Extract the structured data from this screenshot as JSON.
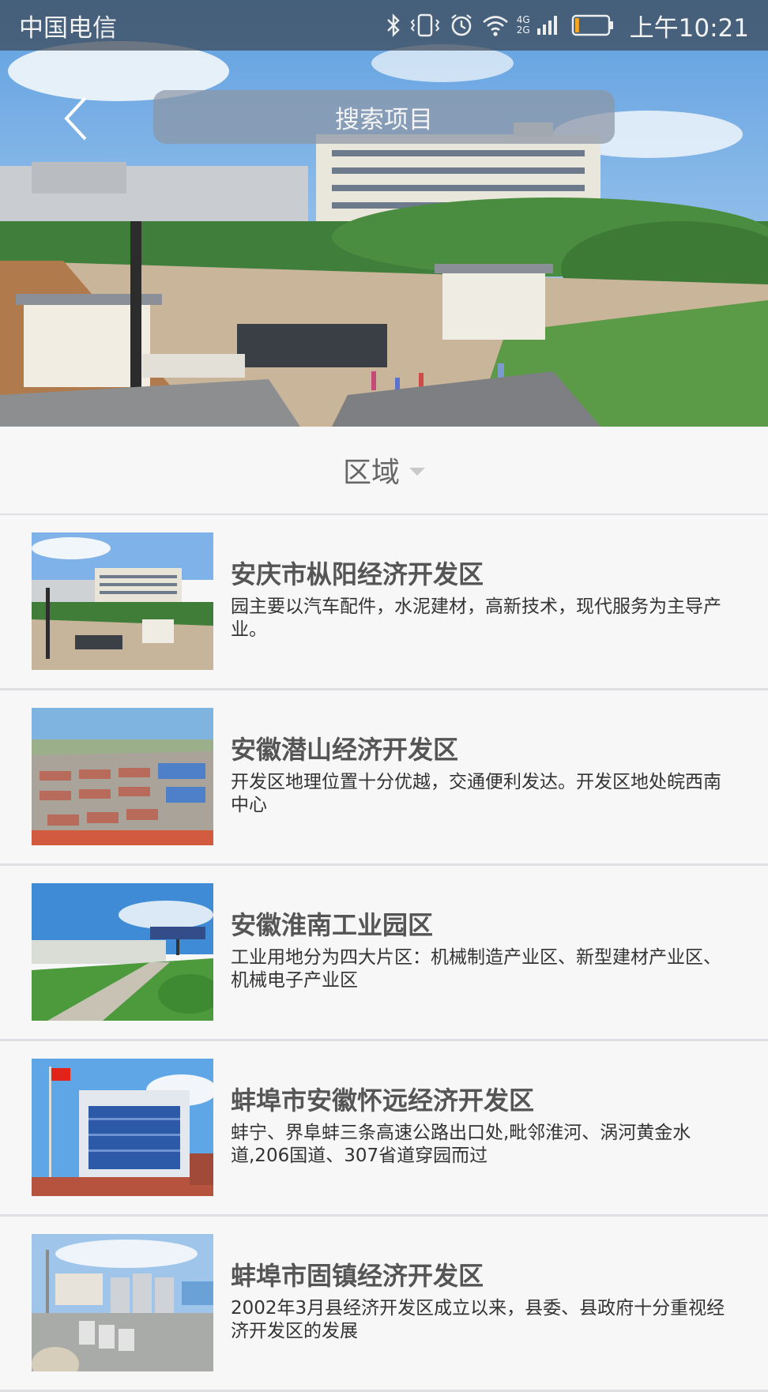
{
  "status_bar": {
    "carrier": "中国电信",
    "network": "4G",
    "network_sub": "2G",
    "time": "上午10:21",
    "icons": [
      "bluetooth-icon",
      "vibrate-icon",
      "alarm-icon",
      "wifi-icon",
      "signal-icon",
      "battery-icon"
    ],
    "battery_level": 0.12
  },
  "header": {
    "back_icon": "chevron-left-icon",
    "search_placeholder": "搜索项目"
  },
  "filter": {
    "label": "区域",
    "icon": "caret-down-icon"
  },
  "items": [
    {
      "title": "安庆市枞阳经济开发区",
      "desc": "园主要以汽车配件，水泥建材，高新技术，现代服务为主导产业。"
    },
    {
      "title": "安徽潜山经济开发区",
      "desc": "开发区地理位置十分优越，交通便利发达。开发区地处皖西南中心"
    },
    {
      "title": "安徽淮南工业园区",
      "desc": "工业用地分为四大片区：机械制造产业区、新型建材产业区、机械电子产业区"
    },
    {
      "title": "蚌埠市安徽怀远经济开发区",
      "desc": "蚌宁、界阜蚌三条高速公路出口处,毗邻淮河、涡河黄金水道,206国道、307省道穿园而过"
    },
    {
      "title": "蚌埠市固镇经济开发区",
      "desc": "2002年3月县经济开发区成立以来，县委、县政府十分重视经济开发区的发展"
    }
  ],
  "colors": {
    "background": "#f7f7f8",
    "divider": "#dedfe2",
    "title": "#555555",
    "status_overlay": "#3c4655"
  }
}
